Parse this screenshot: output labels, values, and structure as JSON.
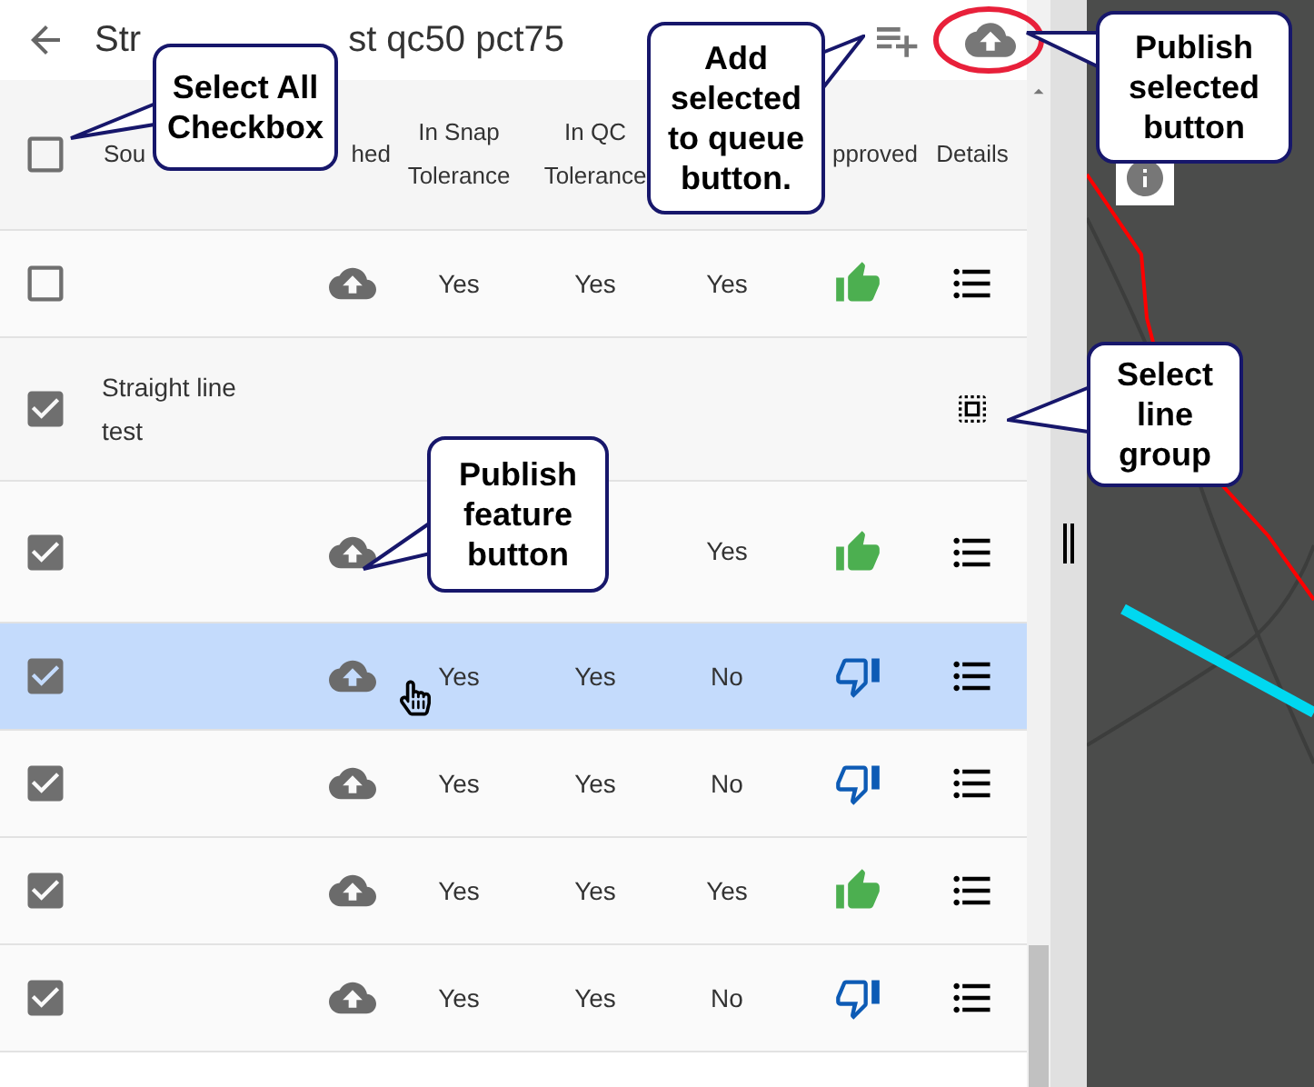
{
  "header": {
    "title_start": "Str",
    "title_end": "st qc50 pct75"
  },
  "table": {
    "select_all": {
      "checked": false
    },
    "columns": [
      {
        "label": "Sou"
      },
      {
        "label": "hed"
      },
      {
        "label": "In Snap Tolerance"
      },
      {
        "label": "In QC Tolerance"
      },
      {
        "label": "pproved"
      },
      {
        "label": "Details"
      }
    ],
    "rows": [
      {
        "kind": "feature",
        "checked": false,
        "selected": false,
        "snap": "Yes",
        "qc": "Yes",
        "column_6": "Yes",
        "approved": true
      },
      {
        "kind": "group",
        "checked": true,
        "selected": false,
        "label": "Straight line test"
      },
      {
        "kind": "feature",
        "checked": true,
        "selected": false,
        "column_6": "Yes",
        "approved": true
      },
      {
        "kind": "feature",
        "checked": true,
        "selected": true,
        "snap": "Yes",
        "qc": "Yes",
        "column_6": "No",
        "approved": false
      },
      {
        "kind": "feature",
        "checked": true,
        "selected": false,
        "snap": "Yes",
        "qc": "Yes",
        "column_6": "No",
        "approved": false
      },
      {
        "kind": "feature",
        "checked": true,
        "selected": false,
        "snap": "Yes",
        "qc": "Yes",
        "column_6": "Yes",
        "approved": true
      },
      {
        "kind": "feature",
        "checked": true,
        "selected": false,
        "snap": "Yes",
        "qc": "Yes",
        "column_6": "No",
        "approved": false
      }
    ]
  },
  "callouts": [
    "Select All Checkbox",
    "Add selected to queue button.",
    "Publish selected button",
    "Publish feature button",
    "Select line group"
  ]
}
